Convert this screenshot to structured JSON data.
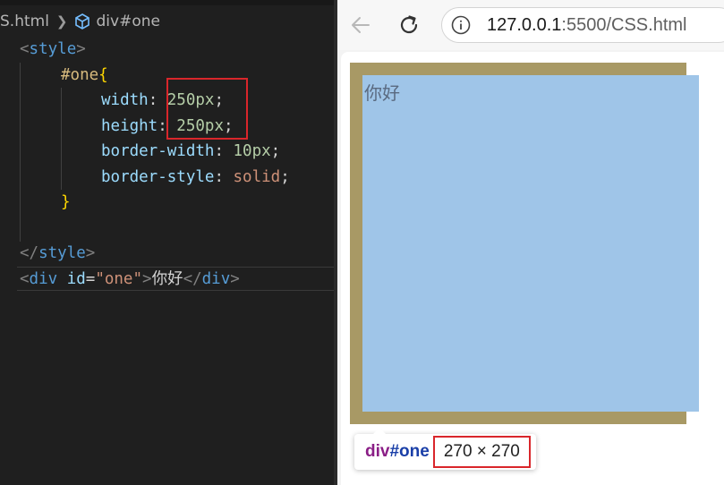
{
  "editor": {
    "breadcrumb": {
      "file": "S.html",
      "element": "div#one"
    },
    "code": {
      "style_open": "style",
      "selector": "#one",
      "brace_open": "{",
      "width_prop": "width",
      "width_value": "250px",
      "height_prop": "height",
      "height_value": "250px",
      "border_width_prop": "border-width",
      "border_width_value": "10px",
      "border_style_prop": "border-style",
      "border_style_value": "solid",
      "brace_close": "}",
      "style_close": "style",
      "div_tag": "div",
      "div_attr": "id",
      "div_attr_value": "\"one\"",
      "div_text": "你好"
    }
  },
  "browser": {
    "url_host": "127.0.0.1",
    "url_rest": ":5500/CSS.html",
    "page_text": "你好",
    "tooltip": {
      "tag": "div",
      "id": "#one",
      "size": "270 × 270"
    },
    "colors": {
      "border": "#a89965",
      "content": "#9fc5e8",
      "highlight": "#d9262b"
    }
  }
}
